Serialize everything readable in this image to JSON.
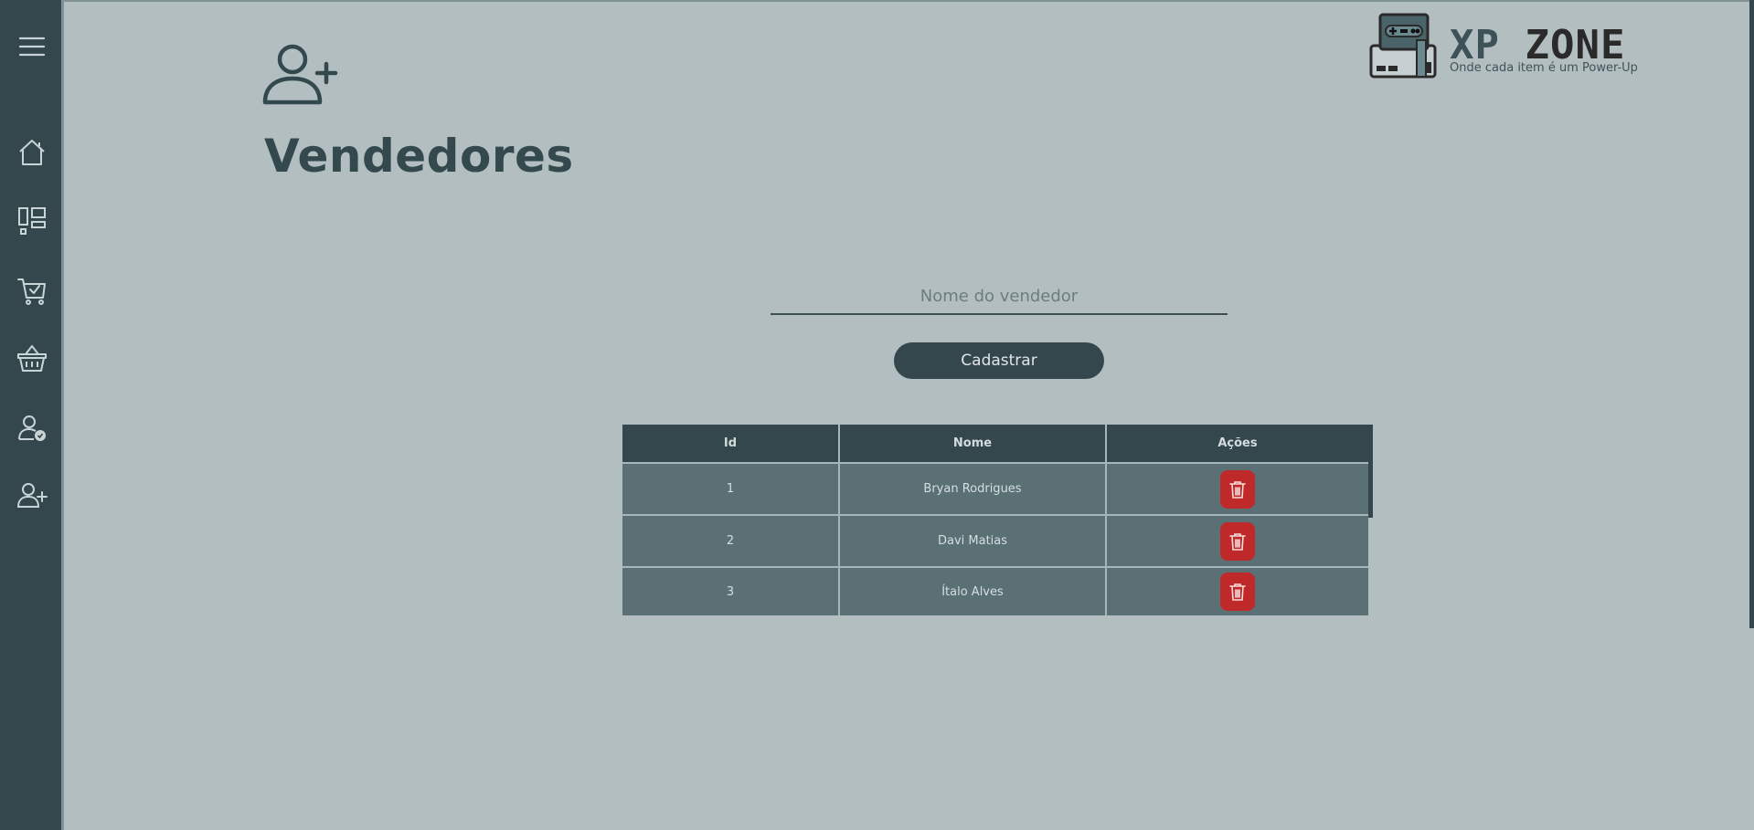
{
  "sidebar": {
    "items": [
      {
        "icon": "menu-icon"
      },
      {
        "icon": "home-icon"
      },
      {
        "icon": "dashboard-icon"
      },
      {
        "icon": "cart-check-icon"
      },
      {
        "icon": "basket-icon"
      },
      {
        "icon": "user-check-icon"
      },
      {
        "icon": "user-add-icon"
      }
    ]
  },
  "header": {
    "title": "Vendedores",
    "icon": "user-add-icon"
  },
  "logo": {
    "name_prefix": "XP",
    "name_suffix": "ZONE",
    "tagline": "Onde cada item é um Power-Up"
  },
  "form": {
    "name_placeholder": "Nome do vendedor",
    "name_value": "",
    "submit_label": "Cadastrar"
  },
  "table": {
    "columns": [
      "Id",
      "Nome",
      "Ações"
    ],
    "rows": [
      {
        "id": "1",
        "nome": "Bryan Rodrigues"
      },
      {
        "id": "2",
        "nome": "Davi Matias"
      },
      {
        "id": "3",
        "nome": "Ítalo Alves"
      }
    ]
  },
  "colors": {
    "background": "#b2bec0",
    "sidebar": "#33474c",
    "accent": "#33474c",
    "row": "#5a7074",
    "danger": "#c0292a"
  }
}
